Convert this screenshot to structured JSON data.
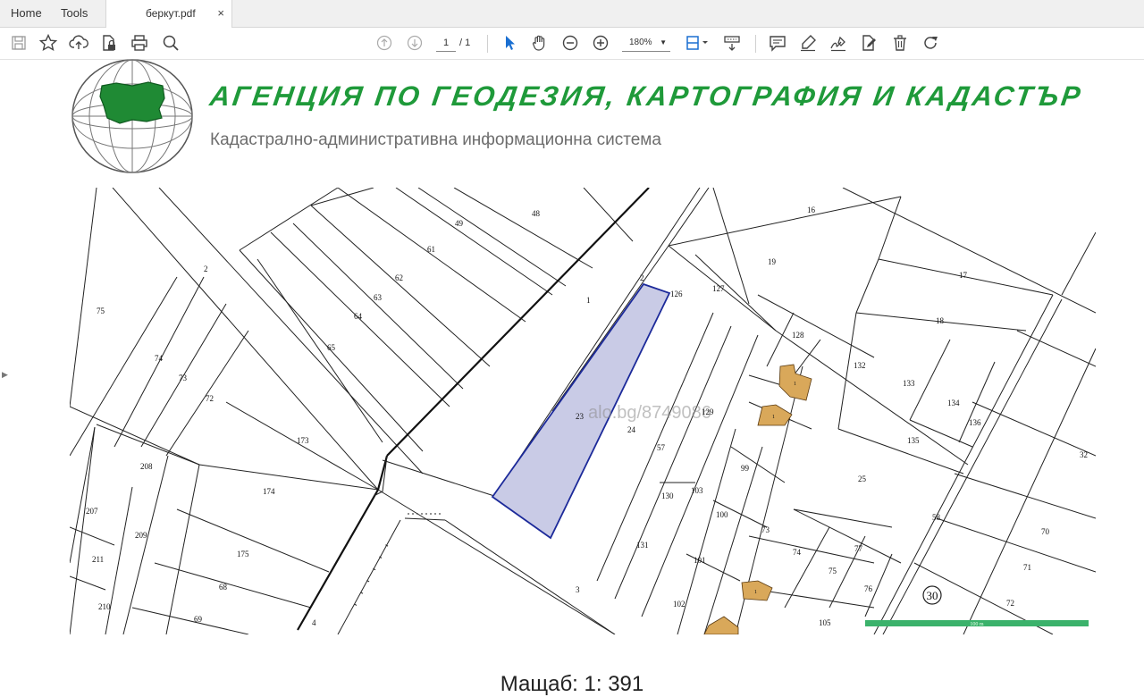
{
  "tabs": {
    "home": "Home",
    "tools": "Tools",
    "doc": "беркут.pdf",
    "close": "×"
  },
  "toolbar": {
    "icons": [
      "save-icon",
      "star-icon",
      "upload-icon",
      "file-lock-icon",
      "print-icon",
      "search-icon",
      "page-up-icon",
      "page-down-icon",
      "select-arrow-icon",
      "hand-icon",
      "zoom-out-icon",
      "zoom-in-icon",
      "fit-page-icon",
      "scroll-mode-icon",
      "comment-icon",
      "highlight-icon",
      "sign-icon",
      "edit-pdf-icon",
      "delete-icon",
      "rotate-icon"
    ],
    "page_current": "1",
    "page_total": "/ 1",
    "zoom": "180%"
  },
  "header": {
    "title": "АГЕНЦИЯ ПО ГЕОДЕЗИЯ, КАРТОГРАФИЯ И КАДАСТЪР",
    "subtitle": "Кадастрално-административна информационна система"
  },
  "map": {
    "watermark": "alo.bg/8749086",
    "scale_bar_label": "100 m",
    "circle_label": "30",
    "highlight_color": "#c9cbe6",
    "highlight_stroke": "#1c2a9a",
    "building_color": "#d9a85a",
    "parcels": {
      "p2a": "2",
      "p75": "75",
      "p74": "74",
      "p73": "73",
      "p72": "72",
      "p208": "208",
      "p207": "207",
      "p209": "209",
      "p211": "211",
      "p210": "210",
      "p65": "65",
      "p64": "64",
      "p63": "63",
      "p62": "62",
      "p61": "61",
      "p49": "49",
      "p48": "48",
      "p173": "173",
      "p174": "174",
      "p175": "175",
      "p68": "68",
      "p69": "69",
      "p1": "1",
      "p2b": "2",
      "p126": "126",
      "p127": "127",
      "p16": "16",
      "p19": "19",
      "p17": "17",
      "p18": "18",
      "p128": "128",
      "p132": "132",
      "p133": "133",
      "p134": "134",
      "p136": "136",
      "p135": "135",
      "p23": "23",
      "p24": "24",
      "p57": "57",
      "p129": "129",
      "p99": "99",
      "p130": "130",
      "p103": "103",
      "p100": "100",
      "p131": "131",
      "p73b": "73",
      "p74b": "74",
      "p75b": "75",
      "p77": "77",
      "p76": "76",
      "p101": "101",
      "p102": "102",
      "p105": "105",
      "p25": "25",
      "p32": "32",
      "p58": "58",
      "p70": "70",
      "p71": "71",
      "p72b": "72",
      "p3": "3",
      "p4": "4",
      "b1a": "1",
      "b1b": "1",
      "b1c": "1"
    }
  },
  "scale": "Мащаб: 1: 391"
}
